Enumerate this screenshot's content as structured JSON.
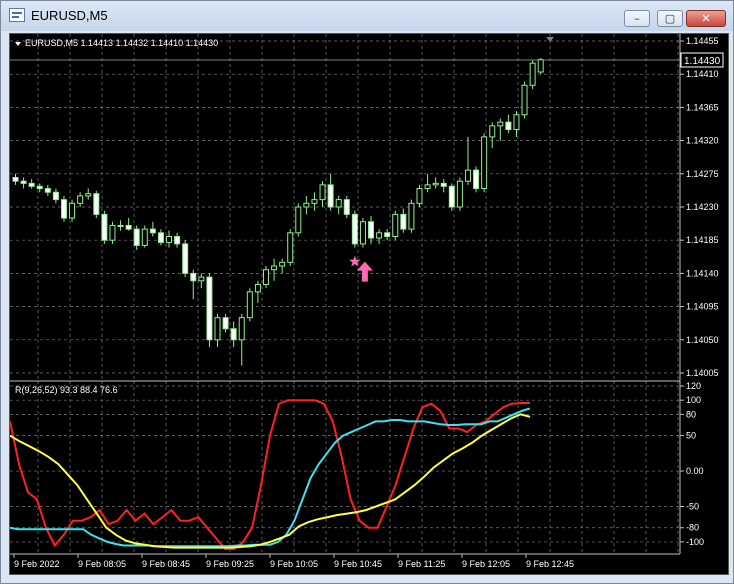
{
  "window": {
    "title": "EURUSD,M5",
    "buttons": {
      "minimize": "–",
      "restore": "▢",
      "close": "✕"
    }
  },
  "price_panel": {
    "header": "EURUSD,M5  1.14413 1.14432 1.14410 1.14430",
    "current_price": "1.14430",
    "y_ticks": [
      "1.14455",
      "1.14410",
      "1.14365",
      "1.14320",
      "1.14275",
      "1.14230",
      "1.14185",
      "1.14140",
      "1.14095",
      "1.14050",
      "1.14005"
    ]
  },
  "indicator_panel": {
    "header": "R(9,26,52) 93.3 88.4 76.6",
    "y_ticks": [
      "120",
      "100",
      "80",
      "50",
      "0.00",
      "-50",
      "-80",
      "-100"
    ]
  },
  "x_axis": {
    "labels": [
      "9 Feb 2022",
      "9 Feb 08:05",
      "9 Feb 08:45",
      "9 Feb 09:25",
      "9 Feb 10:05",
      "9 Feb 10:45",
      "9 Feb 11:25",
      "9 Feb 12:05",
      "9 Feb 12:45"
    ]
  },
  "colors": {
    "bull_candle": "#90ee90",
    "bear_candle": "#ffffff",
    "grid": "#7a7a7a",
    "r_fast": "#ff2020",
    "r_mid": "#40e0f0",
    "r_slow": "#ffff40",
    "signal": "#ff69b4"
  },
  "chart_data": [
    {
      "type": "candlestick",
      "title": "EURUSD,M5",
      "ylim": [
        1.14005,
        1.14455
      ],
      "candles": [
        [
          1.1427,
          1.14275,
          1.1426,
          1.14265
        ],
        [
          1.14265,
          1.1427,
          1.14255,
          1.14262
        ],
        [
          1.14262,
          1.14268,
          1.14255,
          1.14258
        ],
        [
          1.14258,
          1.14262,
          1.1425,
          1.14255
        ],
        [
          1.14255,
          1.1426,
          1.14245,
          1.1425
        ],
        [
          1.1425,
          1.14255,
          1.14235,
          1.1424
        ],
        [
          1.1424,
          1.14245,
          1.1421,
          1.14215
        ],
        [
          1.14215,
          1.1424,
          1.1421,
          1.14235
        ],
        [
          1.14235,
          1.1425,
          1.1423,
          1.14245
        ],
        [
          1.14245,
          1.14255,
          1.1424,
          1.14248
        ],
        [
          1.14248,
          1.14252,
          1.14215,
          1.1422
        ],
        [
          1.1422,
          1.14225,
          1.1418,
          1.14185
        ],
        [
          1.14185,
          1.1421,
          1.1418,
          1.14205
        ],
        [
          1.14205,
          1.14212,
          1.14198,
          1.14205
        ],
        [
          1.14205,
          1.14215,
          1.14198,
          1.142
        ],
        [
          1.142,
          1.14205,
          1.14172,
          1.14178
        ],
        [
          1.14178,
          1.14205,
          1.14175,
          1.142
        ],
        [
          1.142,
          1.1421,
          1.1419,
          1.14195
        ],
        [
          1.14195,
          1.142,
          1.14178,
          1.14182
        ],
        [
          1.14182,
          1.14198,
          1.14175,
          1.1419
        ],
        [
          1.1419,
          1.14195,
          1.14175,
          1.1418
        ],
        [
          1.1418,
          1.14185,
          1.14135,
          1.1414
        ],
        [
          1.1414,
          1.14145,
          1.14105,
          1.1413
        ],
        [
          1.1413,
          1.1414,
          1.1412,
          1.14135
        ],
        [
          1.14135,
          1.1414,
          1.1404,
          1.1405
        ],
        [
          1.1405,
          1.14085,
          1.1404,
          1.1408
        ],
        [
          1.1408,
          1.14085,
          1.1406,
          1.14065
        ],
        [
          1.14065,
          1.14075,
          1.1404,
          1.1405
        ],
        [
          1.1405,
          1.14085,
          1.14015,
          1.1408
        ],
        [
          1.1408,
          1.1412,
          1.14075,
          1.14115
        ],
        [
          1.14115,
          1.1413,
          1.141,
          1.14125
        ],
        [
          1.14125,
          1.1415,
          1.1412,
          1.14145
        ],
        [
          1.14145,
          1.1416,
          1.1413,
          1.1415
        ],
        [
          1.1415,
          1.1416,
          1.1414,
          1.14155
        ],
        [
          1.14155,
          1.142,
          1.1415,
          1.14195
        ],
        [
          1.14195,
          1.14235,
          1.1419,
          1.1423
        ],
        [
          1.1423,
          1.14245,
          1.1422,
          1.14235
        ],
        [
          1.14235,
          1.1425,
          1.14225,
          1.1424
        ],
        [
          1.1424,
          1.14265,
          1.1423,
          1.1426
        ],
        [
          1.1426,
          1.14275,
          1.14225,
          1.1423
        ],
        [
          1.1423,
          1.14245,
          1.1422,
          1.1424
        ],
        [
          1.1424,
          1.14245,
          1.14215,
          1.1422
        ],
        [
          1.1422,
          1.14225,
          1.14175,
          1.1418
        ],
        [
          1.1418,
          1.14215,
          1.14175,
          1.1421
        ],
        [
          1.1421,
          1.14218,
          1.1418,
          1.14188
        ],
        [
          1.14188,
          1.142,
          1.1418,
          1.14195
        ],
        [
          1.14195,
          1.142,
          1.14185,
          1.1419
        ],
        [
          1.1419,
          1.14225,
          1.14185,
          1.1422
        ],
        [
          1.1422,
          1.14228,
          1.14195,
          1.142
        ],
        [
          1.142,
          1.1424,
          1.14195,
          1.14235
        ],
        [
          1.14235,
          1.1426,
          1.1423,
          1.14255
        ],
        [
          1.14255,
          1.14275,
          1.1425,
          1.1426
        ],
        [
          1.1426,
          1.1427,
          1.14255,
          1.14262
        ],
        [
          1.14262,
          1.14268,
          1.1425,
          1.14258
        ],
        [
          1.14258,
          1.14262,
          1.14225,
          1.1423
        ],
        [
          1.1423,
          1.1427,
          1.14225,
          1.14265
        ],
        [
          1.14265,
          1.14325,
          1.1426,
          1.1428
        ],
        [
          1.1428,
          1.14285,
          1.1425,
          1.14255
        ],
        [
          1.14255,
          1.1433,
          1.1425,
          1.14325
        ],
        [
          1.14325,
          1.14345,
          1.1431,
          1.1434
        ],
        [
          1.1434,
          1.1435,
          1.1432,
          1.14345
        ],
        [
          1.14345,
          1.14355,
          1.1433,
          1.14335
        ],
        [
          1.14335,
          1.1436,
          1.14325,
          1.14355
        ],
        [
          1.14355,
          1.144,
          1.1435,
          1.14395
        ],
        [
          1.14395,
          1.1443,
          1.1439,
          1.14425
        ],
        [
          1.14413,
          1.14432,
          1.1441,
          1.1443
        ]
      ],
      "signal_marker": {
        "candle_index": 42,
        "type": "buy"
      }
    },
    {
      "type": "line",
      "title": "R(9,26,52)",
      "ylim": [
        -110,
        120
      ],
      "series": [
        {
          "name": "9",
          "values": [
            70,
            10,
            -30,
            -40,
            -80,
            -105,
            -90,
            -70,
            -70,
            -65,
            -55,
            -75,
            -70,
            -55,
            -70,
            -60,
            -75,
            -65,
            -55,
            -70,
            -70,
            -65,
            -80,
            -95,
            -110,
            -110,
            -100,
            -80,
            -20,
            50,
            95,
            100,
            100,
            100,
            100,
            95,
            70,
            20,
            -40,
            -70,
            -80,
            -80,
            -50,
            -20,
            20,
            60,
            90,
            95,
            85,
            60,
            60,
            55,
            65,
            70,
            80,
            90,
            95,
            96,
            96
          ]
        },
        {
          "name": "26",
          "values": [
            -80,
            -82,
            -82,
            -82,
            -82,
            -82,
            -82,
            -82,
            -82,
            -82,
            -90,
            -95,
            -100,
            -103,
            -105,
            -105,
            -105,
            -105,
            -106,
            -106,
            -106,
            -106,
            -106,
            -106,
            -106,
            -106,
            -106,
            -106,
            -105,
            -105,
            -104,
            -104,
            -104,
            -100,
            -90,
            -70,
            -40,
            -10,
            10,
            25,
            40,
            50,
            55,
            60,
            65,
            70,
            70,
            72,
            72,
            70,
            70,
            70,
            68,
            66,
            65,
            65,
            66,
            66,
            66,
            70,
            70,
            75,
            80,
            85,
            88.4
          ]
        },
        {
          "name": "52",
          "values": [
            50,
            42,
            35,
            28,
            20,
            10,
            -5,
            -20,
            -40,
            -60,
            -80,
            -90,
            -98,
            -102,
            -104,
            -106,
            -107,
            -108,
            -108,
            -108,
            -108,
            -108,
            -108,
            -108,
            -107,
            -106,
            -104,
            -100,
            -95,
            -90,
            -78,
            -72,
            -68,
            -65,
            -62,
            -60,
            -58,
            -55,
            -50,
            -45,
            -40,
            -30,
            -20,
            -8,
            5,
            15,
            25,
            32,
            40,
            50,
            58,
            66,
            74,
            80,
            76.6
          ]
        }
      ]
    }
  ]
}
